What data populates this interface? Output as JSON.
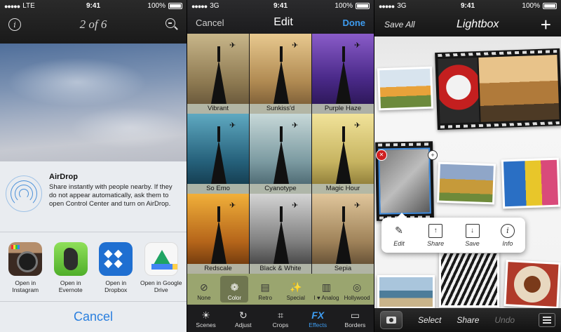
{
  "panel1": {
    "status": {
      "carrier": "LTE",
      "time": "9:41",
      "battery": "100%"
    },
    "nav": {
      "page_count": "2 of 6"
    },
    "airdrop": {
      "title": "AirDrop",
      "description": "Share instantly with people nearby. If they do not appear automatically, ask them to open Control Center and turn on AirDrop."
    },
    "apps": [
      {
        "label": "Open in Instagram"
      },
      {
        "label": "Open in Evernote"
      },
      {
        "label": "Open in Dropbox"
      },
      {
        "label": "Open in Google Drive"
      }
    ],
    "cancel_label": "Cancel"
  },
  "panel2": {
    "status": {
      "carrier": "3G",
      "time": "9:41",
      "battery": "100%"
    },
    "nav": {
      "left": "Cancel",
      "title": "Edit",
      "right": "Done"
    },
    "filters": [
      "Vibrant",
      "Sunkiss'd",
      "Purple Haze",
      "So Emo",
      "Cyanotype",
      "Magic Hour",
      "Redscale",
      "Black & White",
      "Sepia"
    ],
    "fx_categories": [
      "None",
      "Color",
      "Retro",
      "Special",
      "I ♥ Analog",
      "Hollywood"
    ],
    "fx_active": "Color",
    "tabs": [
      "Scenes",
      "Adjust",
      "Crops",
      "Effects",
      "Borders"
    ],
    "tab_active": "Effects"
  },
  "panel3": {
    "status": {
      "carrier": "3G",
      "time": "9:41",
      "battery": "100%"
    },
    "nav": {
      "left": "Save All",
      "title": "Lightbox"
    },
    "popup": [
      "Edit",
      "Share",
      "Save",
      "Info"
    ],
    "bottom": {
      "select": "Select",
      "share": "Share",
      "undo": "Undo"
    }
  }
}
